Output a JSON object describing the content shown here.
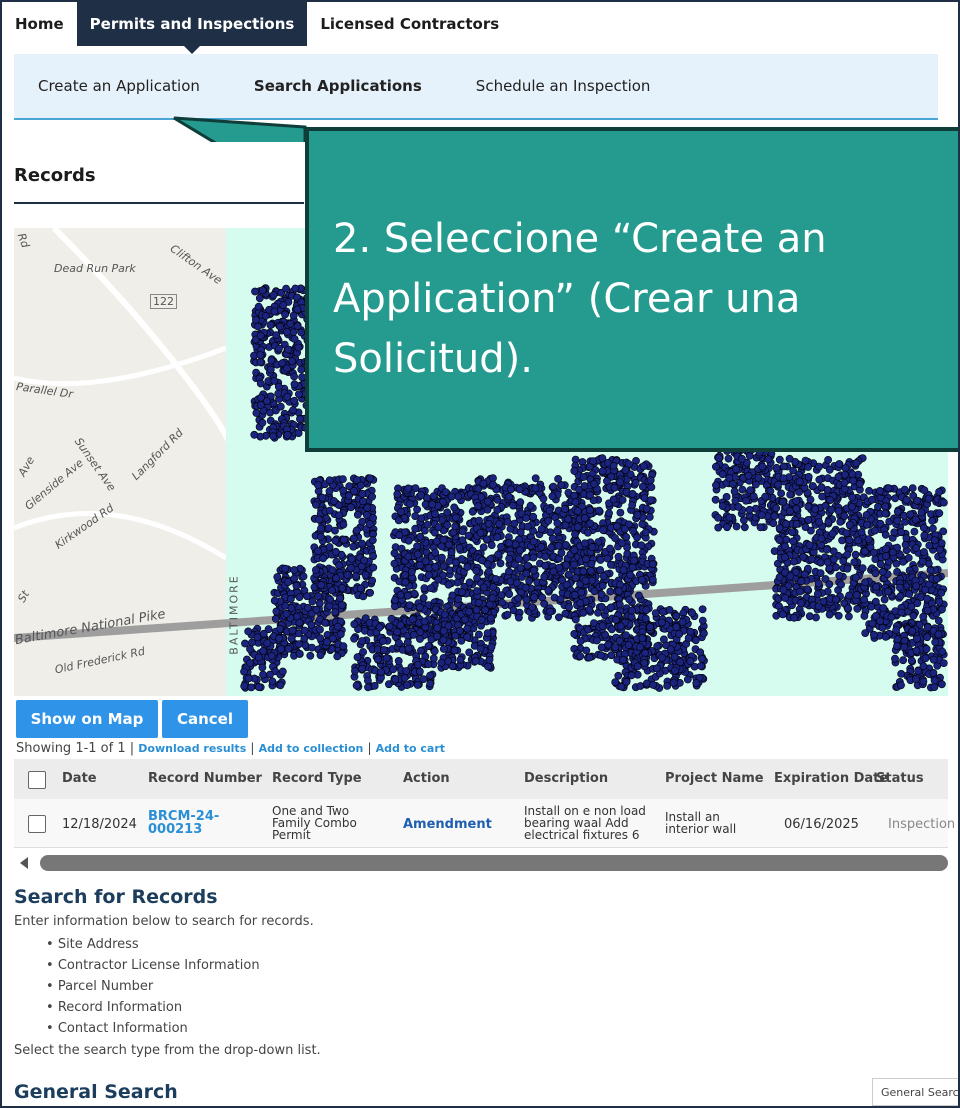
{
  "topnav": {
    "home": "Home",
    "permits": "Permits and Inspections",
    "contractors": "Licensed Contractors"
  },
  "subnav": {
    "create": "Create an Application",
    "search": "Search Applications",
    "schedule": "Schedule an Inspection"
  },
  "records": {
    "title": "Records"
  },
  "map": {
    "labels": {
      "dead_run_park": "Dead Run Park",
      "clifton": "Clifton Ave",
      "route": "122",
      "parallel": "Parallel Dr",
      "sunset": "Sunset Ave",
      "langford": "Langford Rd",
      "glenside": "Glenside Ave",
      "kirkwood": "Kirkwood Rd",
      "national_pike": "Baltimore National Pike",
      "old_frederick": "Old Frederick Rd",
      "baltimore": "BALTIMORE",
      "rd": "Rd",
      "ave": "Ave",
      "st": "St"
    },
    "colors": {
      "parcel_fill": "#d6fbef",
      "dot": "#1a237e",
      "road": "#9e9e9e"
    }
  },
  "callout": {
    "text": "2. Seleccione “Create an Application” (Crear una Solicitud).",
    "color": "#259a8e"
  },
  "buttons": {
    "show_on_map": "Show on Map",
    "cancel": "Cancel"
  },
  "results": {
    "showing": "Showing 1-1 of 1 |",
    "download": "Download results",
    "collection": "Add to collection",
    "cart": "Add to cart",
    "sep": "|"
  },
  "table": {
    "headers": [
      "Date",
      "Record Number",
      "Record Type",
      "Action",
      "Description",
      "Project Name",
      "Expiration Date",
      "Status"
    ],
    "rows": [
      {
        "date": "12/18/2024",
        "record_number": [
          "BRCM-24-",
          "000213"
        ],
        "record_type": [
          "One and Two",
          "Family Combo",
          "Permit"
        ],
        "action": "Amendment",
        "description": [
          "Install on e non load",
          "bearing waal Add",
          "electrical fixtures 6"
        ],
        "project_name": [
          "Install an",
          "interior wall"
        ],
        "expiration_date": "06/16/2025",
        "status": "Inspection"
      }
    ]
  },
  "search": {
    "title": "Search for Records",
    "desc": "Enter information below to search for records.",
    "bullets": [
      "Site Address",
      "Contractor License Information",
      "Parcel Number",
      "Record Information",
      "Contact Information"
    ],
    "select_desc": "Select the search type from the drop-down list."
  },
  "general": {
    "title": "General Search",
    "select_value": "General Search"
  }
}
